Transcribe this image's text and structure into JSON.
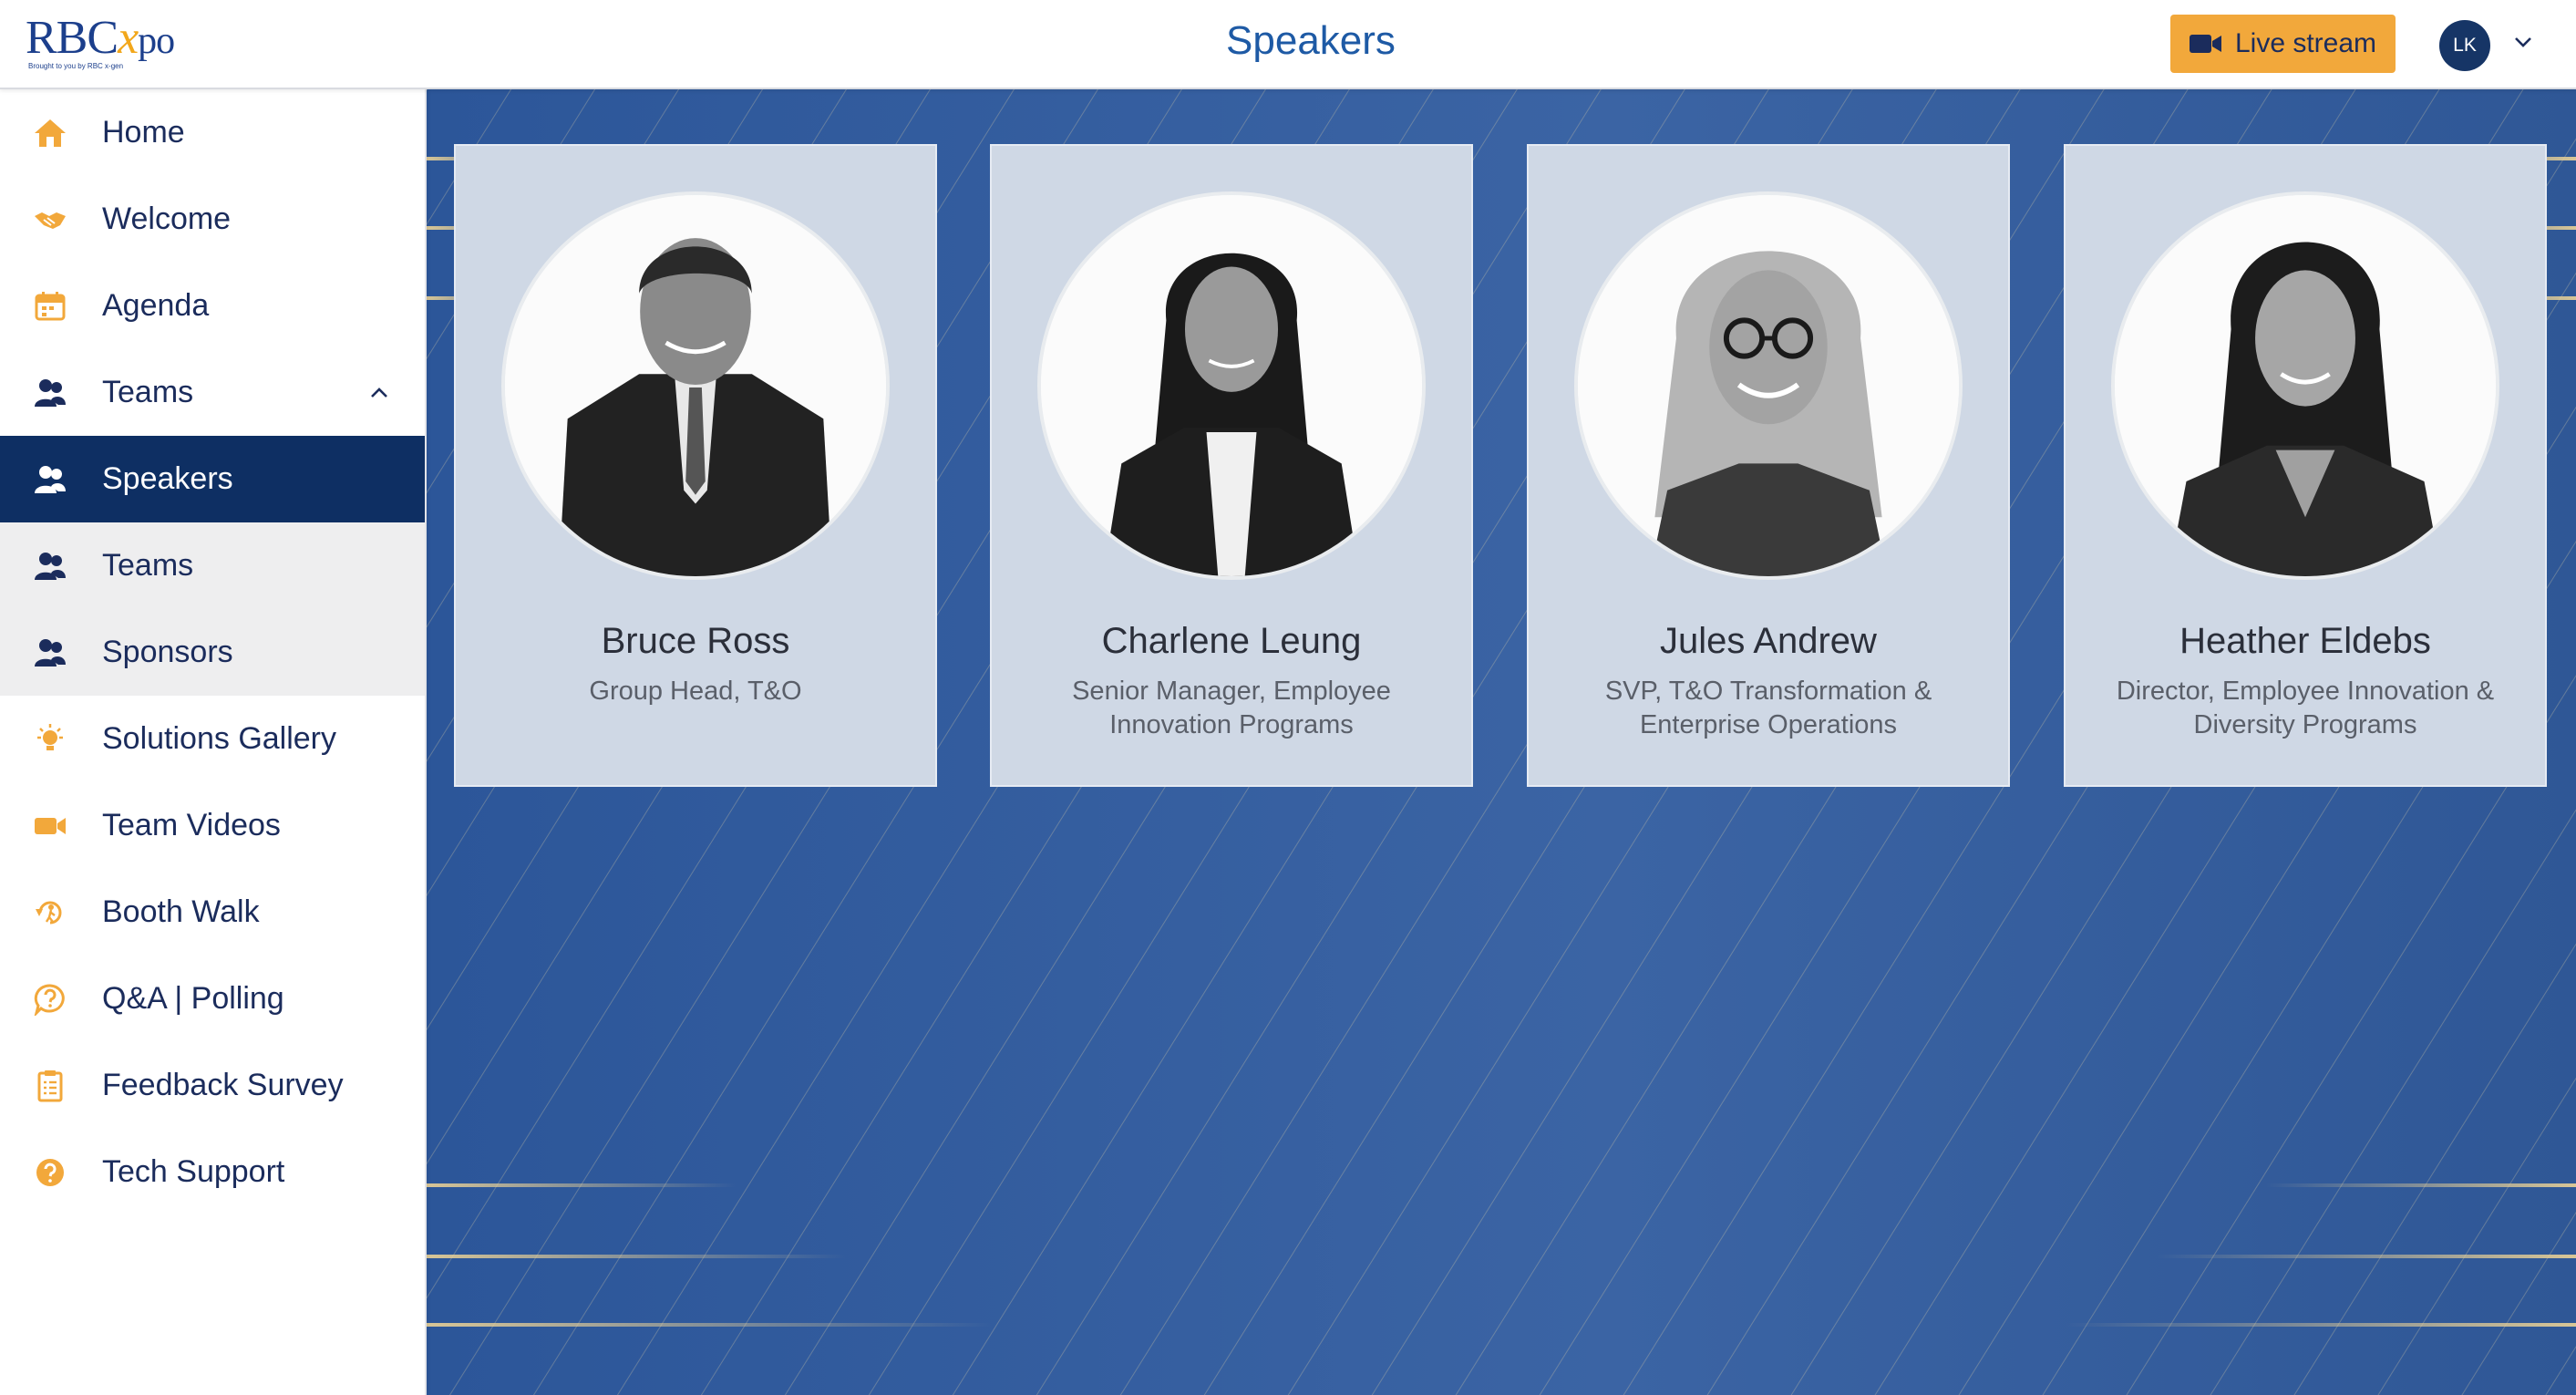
{
  "header": {
    "logo": {
      "main": "RBC",
      "x": "x",
      "po": "po",
      "sub": "Brought to you by RBC x-gen"
    },
    "title": "Speakers",
    "live_stream_label": "Live stream",
    "user_initials": "LK"
  },
  "sidebar": {
    "items": [
      {
        "label": "Home",
        "icon": "home-icon"
      },
      {
        "label": "Welcome",
        "icon": "handshake-icon"
      },
      {
        "label": "Agenda",
        "icon": "calendar-icon"
      },
      {
        "label": "Teams",
        "icon": "people-icon",
        "expanded": true
      },
      {
        "label": "Speakers",
        "icon": "people-icon",
        "active": true
      },
      {
        "label": "Teams",
        "icon": "people-icon"
      },
      {
        "label": "Sponsors",
        "icon": "people-icon"
      },
      {
        "label": "Solutions Gallery",
        "icon": "lightbulb-icon"
      },
      {
        "label": "Team Videos",
        "icon": "video-camera-icon"
      },
      {
        "label": "Booth Walk",
        "icon": "walk-icon"
      },
      {
        "label": "Q&A | Polling",
        "icon": "question-bubble-icon"
      },
      {
        "label": "Feedback Survey",
        "icon": "clipboard-icon"
      },
      {
        "label": "Tech Support",
        "icon": "help-circle-icon"
      }
    ]
  },
  "speakers": [
    {
      "name": "Bruce Ross",
      "role": "Group Head, T&O"
    },
    {
      "name": "Charlene Leung",
      "role": "Senior Manager, Employee Innovation Programs"
    },
    {
      "name": "Jules Andrew",
      "role": "SVP, T&O Transformation & Enterprise Operations"
    },
    {
      "name": "Heather Eldebs",
      "role": "Director, Employee Innovation & Diversity Programs"
    }
  ],
  "colors": {
    "accent_orange": "#f2a83b",
    "brand_navy": "#0e2f63",
    "title_blue": "#1e5aa5",
    "background_blue": "#3b64a4",
    "card": "#cfd8e5"
  }
}
